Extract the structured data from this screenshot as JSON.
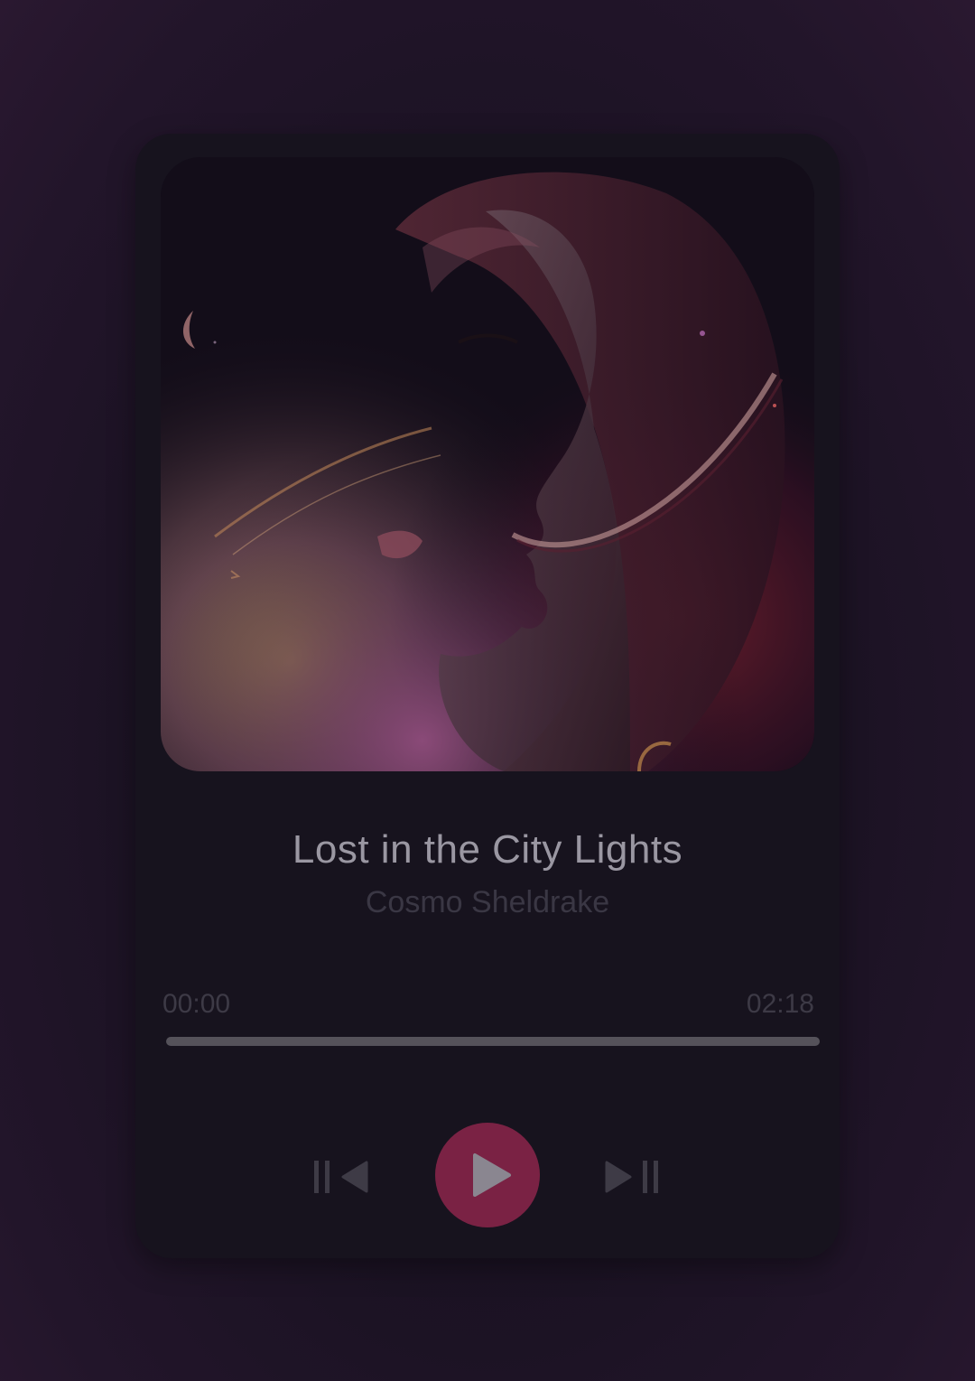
{
  "track": {
    "title": "Lost in the City Lights",
    "artist": "Cosmo Sheldrake"
  },
  "album_art": {
    "description_icon": "album-art-portrait"
  },
  "playback": {
    "current_time": "00:00",
    "duration": "02:18",
    "progress": 0
  },
  "controls": {
    "prev_icon": "skip-previous-icon",
    "play_icon": "play-icon",
    "next_icon": "skip-next-icon"
  },
  "colors": {
    "accent": "#7a2244",
    "background": "#1a1222",
    "card": "#17131e",
    "title_text": "#9a97a2",
    "muted_text": "#3a3744"
  }
}
